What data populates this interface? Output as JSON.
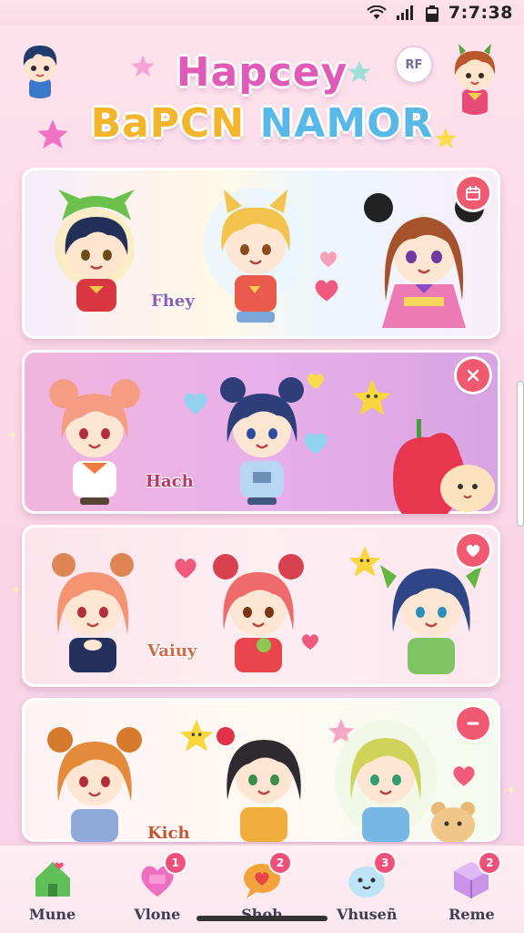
{
  "status_bar": {
    "time": "7:7:38",
    "icons": [
      "wifi-icon",
      "signal-icon",
      "battery-icon"
    ]
  },
  "header": {
    "title_line1": "Hapcey",
    "title_line2_part1": "BaPCN",
    "title_line2_part2": "NAMOR",
    "badge": "RF",
    "colors": {
      "title1": "#e05ab8",
      "title2a": "#f3b52c",
      "title2b": "#58b8e8"
    }
  },
  "cards": [
    {
      "label": "Fhey",
      "action_icon": "calendar-icon",
      "characters": [
        "boy-green-hat",
        "blonde-cat-ears",
        "brown-hair-bow-girl"
      ]
    },
    {
      "label": "Hach",
      "action_icon": "close-icon",
      "characters": [
        "peach-bun-girl",
        "navy-bun-girl",
        "strawberry-creature"
      ]
    },
    {
      "label": "Vaiuy",
      "action_icon": "heart-icon",
      "characters": [
        "peach-hair-girl",
        "red-bun-girl",
        "blue-hair-green-bow-girl"
      ]
    },
    {
      "label": "Kich",
      "action_icon": "minus-icon",
      "characters": [
        "orange-hair-girl",
        "black-hair-star-girl",
        "blonde-girl"
      ]
    }
  ],
  "bottom_nav": [
    {
      "label": "Mune",
      "icon": "house-icon",
      "badge": ""
    },
    {
      "label": "Vlone",
      "icon": "heart-gift-icon",
      "badge": "1"
    },
    {
      "label": "Shoh",
      "icon": "speech-heart-icon",
      "badge": "2"
    },
    {
      "label": "Vhuseñ",
      "icon": "blob-face-icon",
      "badge": "3"
    },
    {
      "label": "Reme",
      "icon": "cube-icon",
      "badge": "2"
    }
  ]
}
